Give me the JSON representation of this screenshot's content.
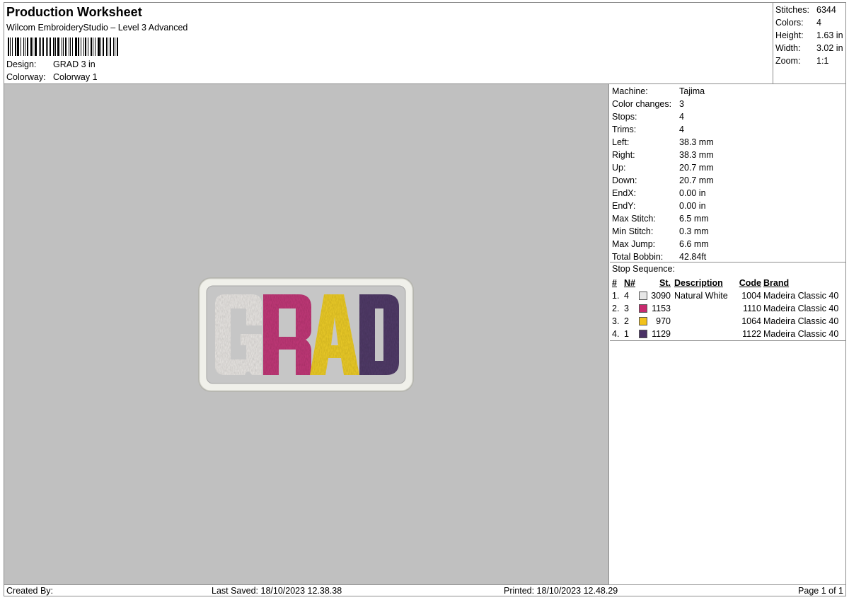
{
  "header": {
    "title": "Production Worksheet",
    "subtitle": "Wilcom EmbroideryStudio – Level 3 Advanced",
    "design_label": "Design:",
    "design_value": "GRAD 3 in",
    "colorway_label": "Colorway:",
    "colorway_value": "Colorway 1"
  },
  "stats": {
    "stitches_label": "Stitches:",
    "stitches_value": "6344",
    "colors_label": "Colors:",
    "colors_value": "4",
    "height_label": "Height:",
    "height_value": "1.63 in",
    "width_label": "Width:",
    "width_value": "3.02 in",
    "zoom_label": "Zoom:",
    "zoom_value": "1:1"
  },
  "design_preview": {
    "text": "GRAD",
    "letter_colors": [
      "#ece9e6",
      "#c43a7a",
      "#f0cf2c",
      "#533d6b"
    ],
    "border_color": "#f0f0ea"
  },
  "machine_info": [
    {
      "label": "Machine:",
      "value": "Tajima"
    },
    {
      "label": "Color changes:",
      "value": "3"
    },
    {
      "label": "Stops:",
      "value": "4"
    },
    {
      "label": "Trims:",
      "value": "4"
    },
    {
      "label": "Left:",
      "value": "38.3 mm"
    },
    {
      "label": "Right:",
      "value": "38.3 mm"
    },
    {
      "label": "Up:",
      "value": "20.7 mm"
    },
    {
      "label": "Down:",
      "value": "20.7 mm"
    },
    {
      "label": "EndX:",
      "value": "0.00 in"
    },
    {
      "label": "EndY:",
      "value": "0.00 in"
    },
    {
      "label": "Max Stitch:",
      "value": "6.5 mm"
    },
    {
      "label": "Min Stitch:",
      "value": "0.3 mm"
    },
    {
      "label": "Max Jump:",
      "value": "6.6 mm"
    },
    {
      "label": "Total Bobbin:",
      "value": "42.84ft"
    }
  ],
  "stop_sequence": {
    "title": "Stop Sequence:",
    "headers": {
      "idx": "#",
      "n": "N#",
      "st": "St.",
      "desc": "Description",
      "code": "Code",
      "brand": "Brand"
    },
    "rows": [
      {
        "idx": "1.",
        "n": "4",
        "color": "#e6e6e6",
        "st": "3090",
        "desc": "Natural White",
        "code": "1004",
        "brand": "Madeira Classic 40"
      },
      {
        "idx": "2.",
        "n": "3",
        "color": "#c82a6e",
        "st": "1153",
        "desc": "",
        "code": "1110",
        "brand": "Madeira Classic 40"
      },
      {
        "idx": "3.",
        "n": "2",
        "color": "#f2c21c",
        "st": "970",
        "desc": "",
        "code": "1064",
        "brand": "Madeira Classic 40"
      },
      {
        "idx": "4.",
        "n": "1",
        "color": "#4b3266",
        "st": "1129",
        "desc": "",
        "code": "1122",
        "brand": "Madeira Classic 40"
      }
    ]
  },
  "footer": {
    "created_by": "Created By:",
    "last_saved": "Last Saved: 18/10/2023 12.38.38",
    "printed": "Printed: 18/10/2023 12.48.29",
    "page": "Page 1 of 1"
  }
}
